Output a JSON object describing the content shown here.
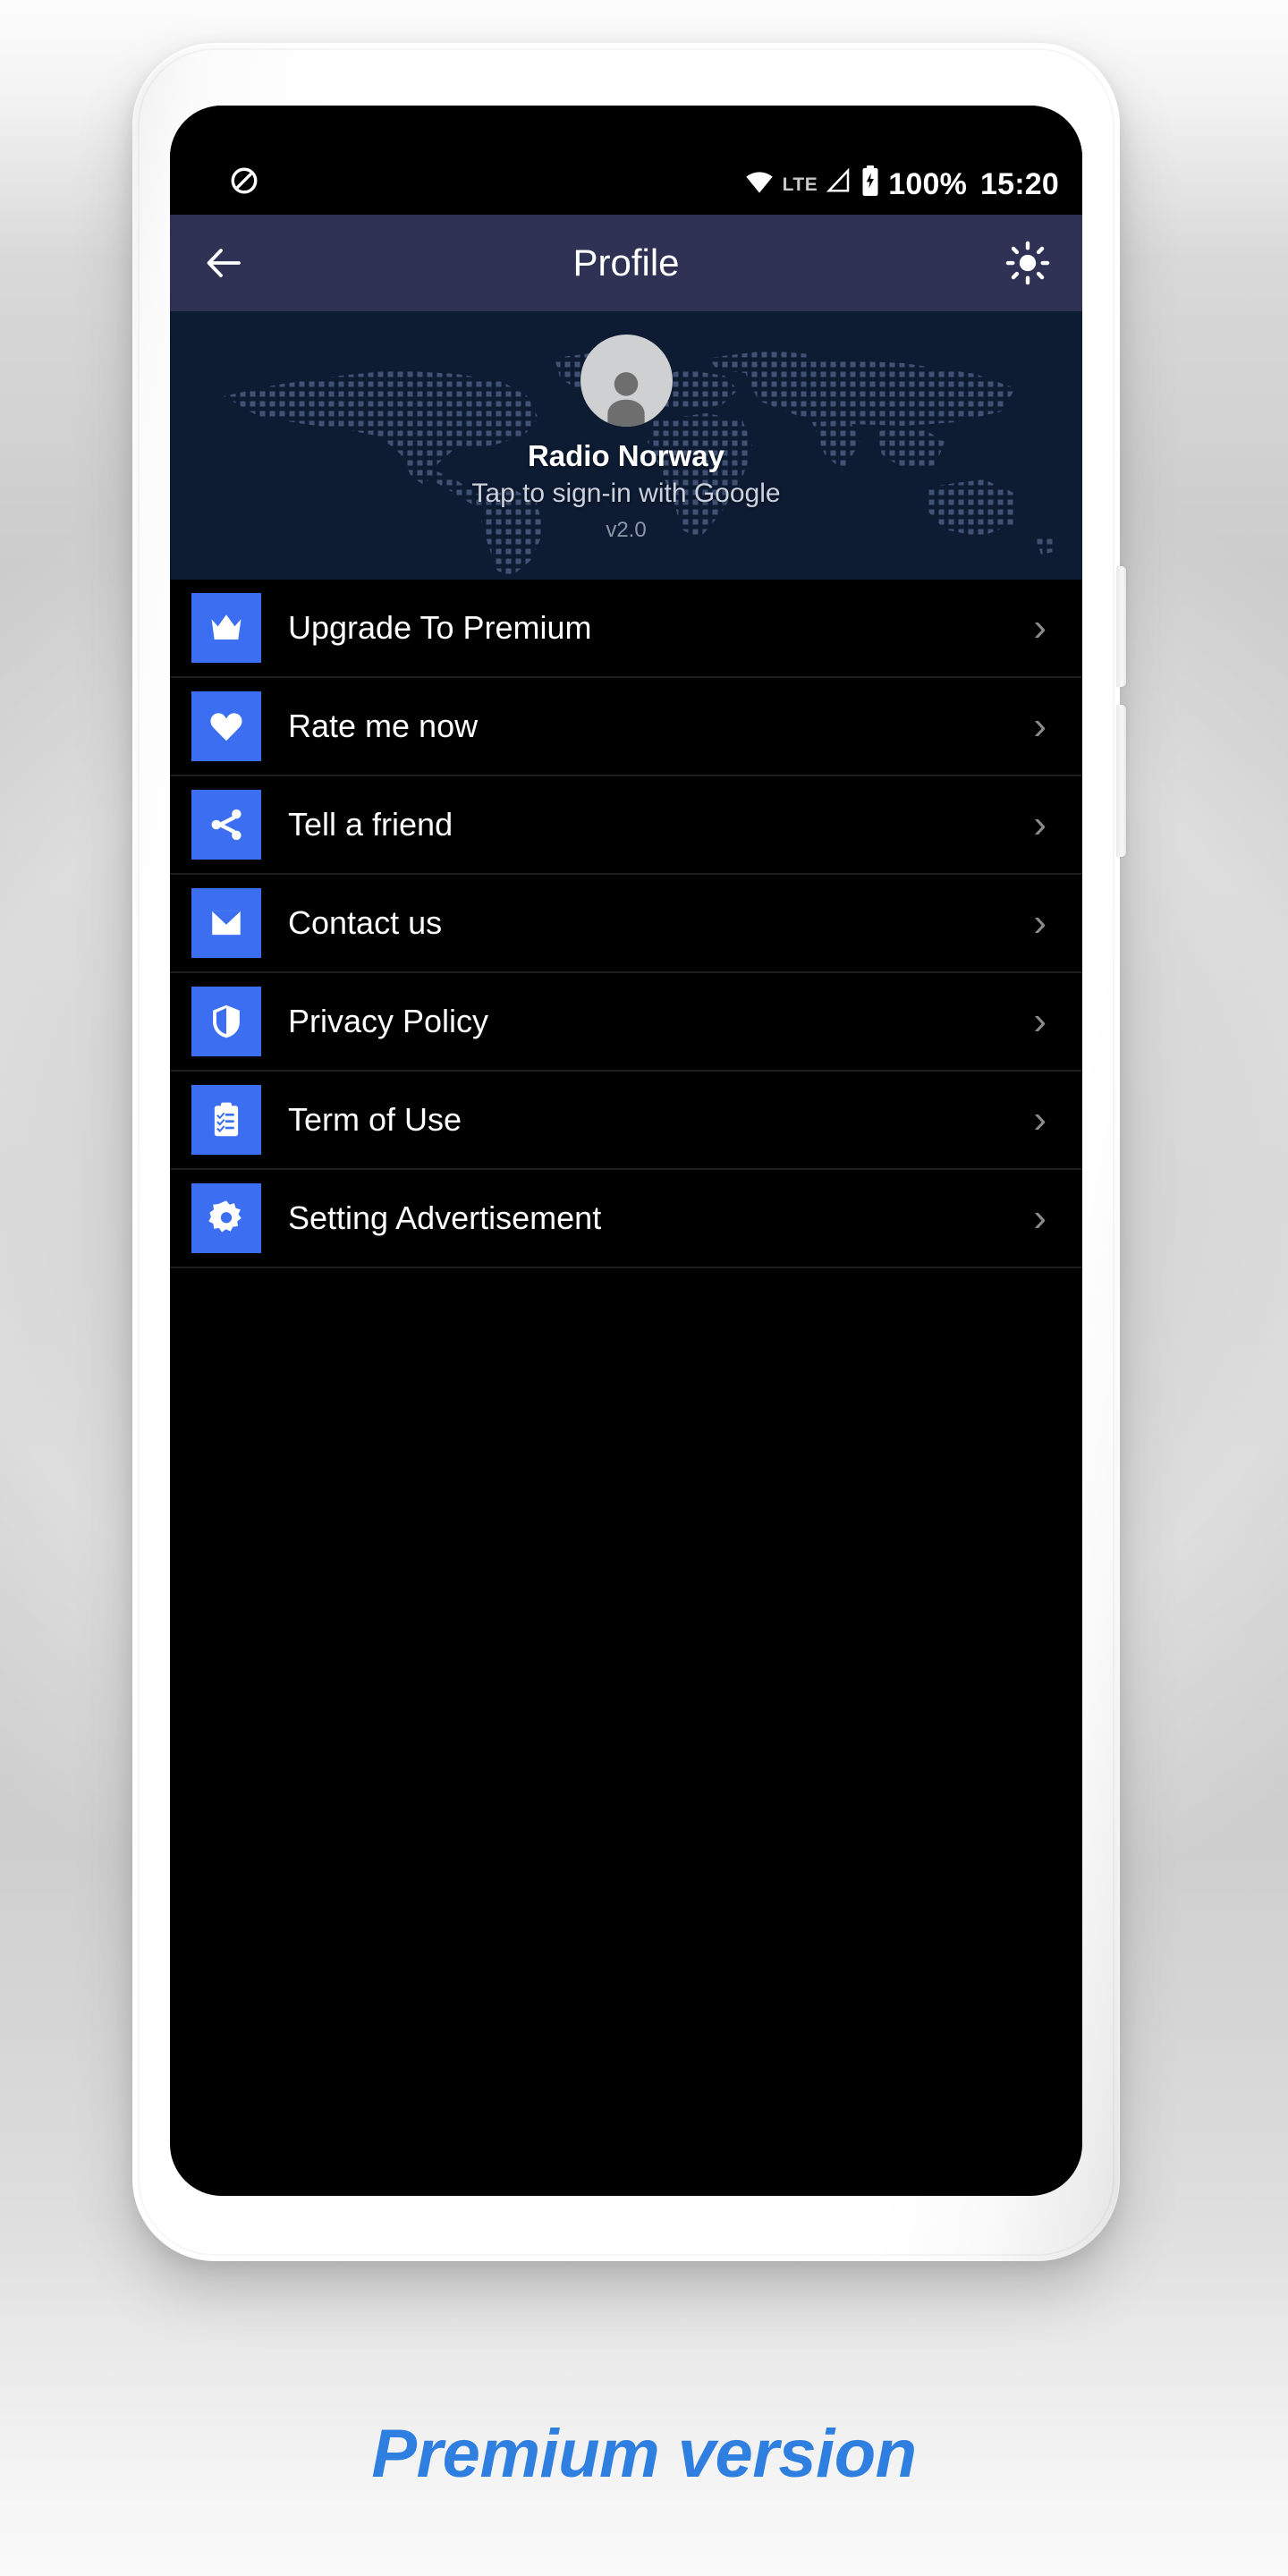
{
  "statusbar": {
    "mute_icon": "do-not-disturb-icon",
    "wifi_icon": "wifi-icon",
    "network": "LTE",
    "signal_icon": "signal-icon",
    "battery_icon": "battery-charging-icon",
    "battery_percent": "100%",
    "time": "15:20"
  },
  "appbar": {
    "back_icon": "arrow-left-icon",
    "title": "Profile",
    "theme_icon": "sun-icon"
  },
  "profile": {
    "avatar_icon": "person-avatar-icon",
    "name": "Radio Norway",
    "signin_hint": "Tap to sign-in with Google",
    "version": "v2.0",
    "background": "dotted-world-map"
  },
  "menu": {
    "items": [
      {
        "icon": "crown-icon",
        "label": "Upgrade To Premium",
        "chevron": "›"
      },
      {
        "icon": "heart-icon",
        "label": "Rate me now",
        "chevron": "›"
      },
      {
        "icon": "share-icon",
        "label": "Tell a friend",
        "chevron": "›"
      },
      {
        "icon": "envelope-icon",
        "label": "Contact us",
        "chevron": "›"
      },
      {
        "icon": "shield-icon",
        "label": "Privacy Policy",
        "chevron": "›"
      },
      {
        "icon": "clipboard-icon",
        "label": "Term of Use",
        "chevron": "›"
      },
      {
        "icon": "gear-icon",
        "label": "Setting Advertisement",
        "chevron": "›"
      }
    ]
  },
  "caption": {
    "text": "Premium version"
  },
  "colors": {
    "accent_blue": "#3b6ef0",
    "appbar_navy": "#2f3254",
    "profile_navy": "#0d1b33",
    "screen_black": "#000000",
    "caption_blue": "#2f7fe0",
    "chevron_gray": "#8a8a8a"
  }
}
